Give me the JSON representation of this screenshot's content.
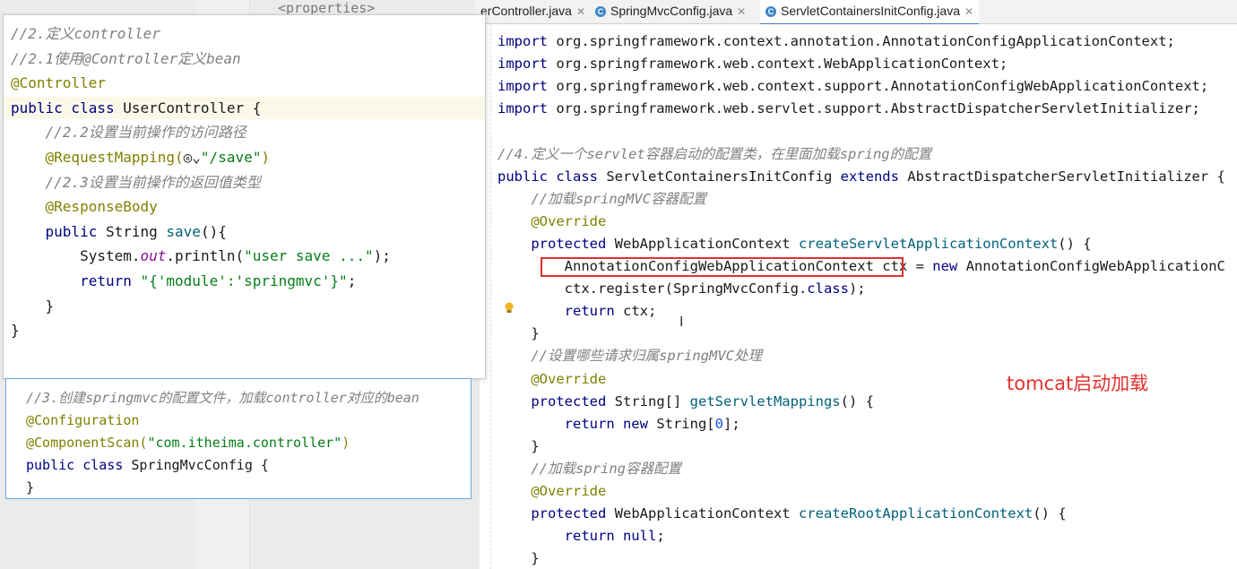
{
  "tabs": [
    {
      "label": "erController.java",
      "active": false
    },
    {
      "label": "SpringMvcConfig.java",
      "active": false
    },
    {
      "label": "ServletContainersInitConfig.java",
      "active": true
    }
  ],
  "background_fragment": "<properties>",
  "panel_a": {
    "lines": [
      [
        [
          "cm",
          "//2.定义controller"
        ]
      ],
      [
        [
          "cm",
          "//2.1使用@Controller定义bean"
        ]
      ],
      [
        [
          "an",
          "@Controller"
        ]
      ],
      [
        [
          "kw",
          "public class "
        ],
        [
          "pl",
          "UserController "
        ],
        [
          "pl",
          "{"
        ]
      ],
      [
        [
          "pl",
          "    "
        ],
        [
          "cm",
          "//2.2设置当前操作的访问路径"
        ]
      ],
      [
        [
          "pl",
          "    "
        ],
        [
          "an",
          "@RequestMapping("
        ],
        [
          "pl",
          "◎⌄"
        ],
        [
          "st",
          "\"/save\""
        ],
        [
          "an",
          ")"
        ]
      ],
      [
        [
          "pl",
          "    "
        ],
        [
          "cm",
          "//2.3设置当前操作的返回值类型"
        ]
      ],
      [
        [
          "pl",
          "    "
        ],
        [
          "an",
          "@ResponseBody"
        ]
      ],
      [
        [
          "pl",
          "    "
        ],
        [
          "kw",
          "public "
        ],
        [
          "pl",
          "String "
        ],
        [
          "fn",
          "save"
        ],
        [
          "pl",
          "(){"
        ]
      ],
      [
        [
          "pl",
          "        System."
        ],
        [
          "it",
          "out"
        ],
        [
          "pl",
          ".println("
        ],
        [
          "st",
          "\"user save ...\""
        ],
        [
          "pl",
          ");"
        ]
      ],
      [
        [
          "pl",
          "        "
        ],
        [
          "kw",
          "return "
        ],
        [
          "st",
          "\"{'module':'springmvc'}\""
        ],
        [
          "pl",
          ";"
        ]
      ],
      [
        [
          "pl",
          "    }"
        ]
      ],
      [
        [
          "pl",
          "}"
        ]
      ]
    ]
  },
  "panel_b": {
    "lines": [
      [
        [
          "cm",
          "//3.创建springmvc的配置文件，加载controller对应的bean"
        ]
      ],
      [
        [
          "an",
          "@Configuration"
        ]
      ],
      [
        [
          "an",
          "@ComponentScan("
        ],
        [
          "st",
          "\"com.itheima.controller\""
        ],
        [
          "an",
          ")"
        ]
      ],
      [
        [
          "kw",
          "public class "
        ],
        [
          "pl",
          "SpringMvcConfig {"
        ]
      ],
      [
        [
          "pl",
          "}"
        ]
      ]
    ]
  },
  "editor": {
    "lines": [
      [
        [
          "kw",
          "import "
        ],
        [
          "pl",
          "org.springframework.context.annotation.AnnotationConfigApplicationContext;"
        ]
      ],
      [
        [
          "kw",
          "import "
        ],
        [
          "pl",
          "org.springframework.web.context.WebApplicationContext;"
        ]
      ],
      [
        [
          "kw",
          "import "
        ],
        [
          "pl",
          "org.springframework.web.context.support.AnnotationConfigWebApplicationContext;"
        ]
      ],
      [
        [
          "kw",
          "import "
        ],
        [
          "pl",
          "org.springframework.web.servlet.support.AbstractDispatcherServletInitializer;"
        ]
      ],
      [],
      [
        [
          "cm",
          "//4.定义一个servlet容器启动的配置类，在里面加载spring的配置"
        ]
      ],
      [
        [
          "kw",
          "public class "
        ],
        [
          "pl",
          "ServletContainersInitConfig "
        ],
        [
          "kw",
          "extends "
        ],
        [
          "pl",
          "AbstractDispatcherServletInitializer {"
        ]
      ],
      [
        [
          "pl",
          "    "
        ],
        [
          "cm",
          "//加载springMVC容器配置"
        ]
      ],
      [
        [
          "pl",
          "    "
        ],
        [
          "an",
          "@Override"
        ]
      ],
      [
        [
          "pl",
          "    "
        ],
        [
          "kw",
          "protected "
        ],
        [
          "pl",
          "WebApplicationContext "
        ],
        [
          "fn",
          "createServletApplicationContext"
        ],
        [
          "pl",
          "() {"
        ]
      ],
      [
        [
          "pl",
          "        AnnotationConfigWebApplicationContext ctx = "
        ],
        [
          "kw",
          "new "
        ],
        [
          "pl",
          "AnnotationConfigWebApplicationC"
        ]
      ],
      [
        [
          "pl",
          "        ctx.register(SpringMvcConfig."
        ],
        [
          "kw",
          "class"
        ],
        [
          "pl",
          ");"
        ]
      ],
      [
        [
          "pl",
          "        "
        ],
        [
          "kw",
          "return "
        ],
        [
          "pl",
          "ctx;"
        ]
      ],
      [
        [
          "pl",
          "    }"
        ]
      ],
      [
        [
          "pl",
          "    "
        ],
        [
          "cm",
          "//设置哪些请求归属springMVC处理"
        ]
      ],
      [
        [
          "pl",
          "    "
        ],
        [
          "an",
          "@Override"
        ]
      ],
      [
        [
          "pl",
          "    "
        ],
        [
          "kw",
          "protected "
        ],
        [
          "pl",
          "String[] "
        ],
        [
          "fn",
          "getServletMappings"
        ],
        [
          "pl",
          "() {"
        ]
      ],
      [
        [
          "pl",
          "        "
        ],
        [
          "kw",
          "return new "
        ],
        [
          "pl",
          "String["
        ],
        [
          "nu",
          "0"
        ],
        [
          "pl",
          "];"
        ]
      ],
      [
        [
          "pl",
          "    }"
        ]
      ],
      [
        [
          "pl",
          "    "
        ],
        [
          "cm",
          "//加载spring容器配置"
        ]
      ],
      [
        [
          "pl",
          "    "
        ],
        [
          "an",
          "@Override"
        ]
      ],
      [
        [
          "pl",
          "    "
        ],
        [
          "kw",
          "protected "
        ],
        [
          "pl",
          "WebApplicationContext "
        ],
        [
          "fn",
          "createRootApplicationContext"
        ],
        [
          "pl",
          "() {"
        ]
      ],
      [
        [
          "pl",
          "        "
        ],
        [
          "kw",
          "return null"
        ],
        [
          "pl",
          ";"
        ]
      ],
      [
        [
          "pl",
          "    }"
        ]
      ]
    ]
  },
  "annotation_note": "tomcat启动加载",
  "colors": {
    "annotation_red": "#e5322d",
    "tab_accent": "#4083c9"
  }
}
